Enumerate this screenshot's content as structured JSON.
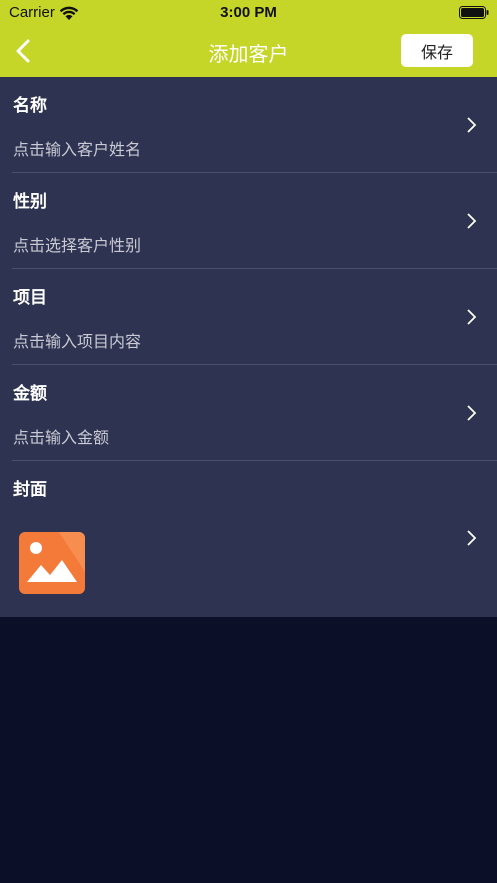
{
  "status_bar": {
    "carrier": "Carrier",
    "time": "3:00 PM"
  },
  "nav": {
    "title": "添加客户",
    "save_label": "保存"
  },
  "colors": {
    "accent": "#c5d629",
    "panel": "#2d3350",
    "background": "#0b1028",
    "cover_icon": "#f47a3a"
  },
  "form": {
    "rows": [
      {
        "label": "名称",
        "hint": "点击输入客户姓名"
      },
      {
        "label": "性别",
        "hint": "点击选择客户性别"
      },
      {
        "label": "项目",
        "hint": "点击输入项目内容"
      },
      {
        "label": "金额",
        "hint": "点击输入金额"
      }
    ],
    "cover": {
      "label": "封面",
      "icon": "image-placeholder-icon"
    }
  }
}
